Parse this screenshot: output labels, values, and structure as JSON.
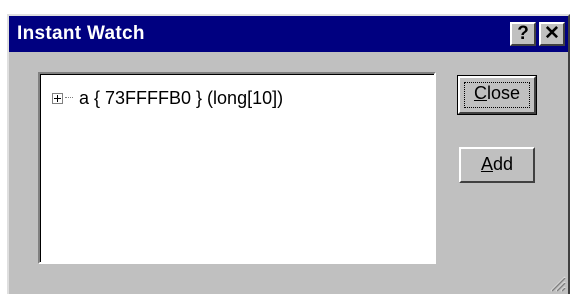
{
  "window": {
    "title": "Instant Watch",
    "help_label": "?",
    "close_label": "✕"
  },
  "tree": {
    "items": [
      {
        "expander": "plus-box",
        "text": "a  { 73FFFFB0 } (long[10])"
      }
    ]
  },
  "buttons": {
    "close": {
      "mnemonic": "C",
      "rest": "lose"
    },
    "add": {
      "mnemonic": "A",
      "rest": "dd"
    }
  },
  "colors": {
    "titlebar": "#000080",
    "face": "#c0c0c0",
    "list_background": "#ffffff"
  }
}
